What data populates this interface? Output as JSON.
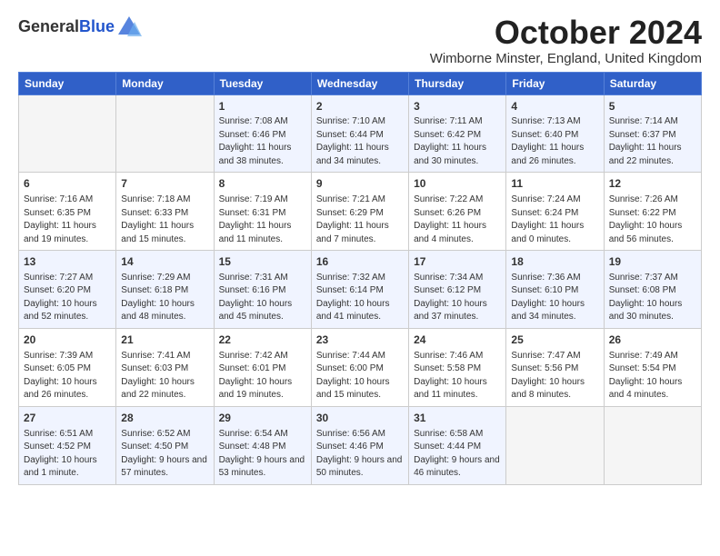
{
  "logo": {
    "general": "General",
    "blue": "Blue"
  },
  "title": "October 2024",
  "subtitle": "Wimborne Minster, England, United Kingdom",
  "days_of_week": [
    "Sunday",
    "Monday",
    "Tuesday",
    "Wednesday",
    "Thursday",
    "Friday",
    "Saturday"
  ],
  "weeks": [
    [
      {
        "day": "",
        "info": ""
      },
      {
        "day": "",
        "info": ""
      },
      {
        "day": "1",
        "info": "Sunrise: 7:08 AM\nSunset: 6:46 PM\nDaylight: 11 hours and 38 minutes."
      },
      {
        "day": "2",
        "info": "Sunrise: 7:10 AM\nSunset: 6:44 PM\nDaylight: 11 hours and 34 minutes."
      },
      {
        "day": "3",
        "info": "Sunrise: 7:11 AM\nSunset: 6:42 PM\nDaylight: 11 hours and 30 minutes."
      },
      {
        "day": "4",
        "info": "Sunrise: 7:13 AM\nSunset: 6:40 PM\nDaylight: 11 hours and 26 minutes."
      },
      {
        "day": "5",
        "info": "Sunrise: 7:14 AM\nSunset: 6:37 PM\nDaylight: 11 hours and 22 minutes."
      }
    ],
    [
      {
        "day": "6",
        "info": "Sunrise: 7:16 AM\nSunset: 6:35 PM\nDaylight: 11 hours and 19 minutes."
      },
      {
        "day": "7",
        "info": "Sunrise: 7:18 AM\nSunset: 6:33 PM\nDaylight: 11 hours and 15 minutes."
      },
      {
        "day": "8",
        "info": "Sunrise: 7:19 AM\nSunset: 6:31 PM\nDaylight: 11 hours and 11 minutes."
      },
      {
        "day": "9",
        "info": "Sunrise: 7:21 AM\nSunset: 6:29 PM\nDaylight: 11 hours and 7 minutes."
      },
      {
        "day": "10",
        "info": "Sunrise: 7:22 AM\nSunset: 6:26 PM\nDaylight: 11 hours and 4 minutes."
      },
      {
        "day": "11",
        "info": "Sunrise: 7:24 AM\nSunset: 6:24 PM\nDaylight: 11 hours and 0 minutes."
      },
      {
        "day": "12",
        "info": "Sunrise: 7:26 AM\nSunset: 6:22 PM\nDaylight: 10 hours and 56 minutes."
      }
    ],
    [
      {
        "day": "13",
        "info": "Sunrise: 7:27 AM\nSunset: 6:20 PM\nDaylight: 10 hours and 52 minutes."
      },
      {
        "day": "14",
        "info": "Sunrise: 7:29 AM\nSunset: 6:18 PM\nDaylight: 10 hours and 48 minutes."
      },
      {
        "day": "15",
        "info": "Sunrise: 7:31 AM\nSunset: 6:16 PM\nDaylight: 10 hours and 45 minutes."
      },
      {
        "day": "16",
        "info": "Sunrise: 7:32 AM\nSunset: 6:14 PM\nDaylight: 10 hours and 41 minutes."
      },
      {
        "day": "17",
        "info": "Sunrise: 7:34 AM\nSunset: 6:12 PM\nDaylight: 10 hours and 37 minutes."
      },
      {
        "day": "18",
        "info": "Sunrise: 7:36 AM\nSunset: 6:10 PM\nDaylight: 10 hours and 34 minutes."
      },
      {
        "day": "19",
        "info": "Sunrise: 7:37 AM\nSunset: 6:08 PM\nDaylight: 10 hours and 30 minutes."
      }
    ],
    [
      {
        "day": "20",
        "info": "Sunrise: 7:39 AM\nSunset: 6:05 PM\nDaylight: 10 hours and 26 minutes."
      },
      {
        "day": "21",
        "info": "Sunrise: 7:41 AM\nSunset: 6:03 PM\nDaylight: 10 hours and 22 minutes."
      },
      {
        "day": "22",
        "info": "Sunrise: 7:42 AM\nSunset: 6:01 PM\nDaylight: 10 hours and 19 minutes."
      },
      {
        "day": "23",
        "info": "Sunrise: 7:44 AM\nSunset: 6:00 PM\nDaylight: 10 hours and 15 minutes."
      },
      {
        "day": "24",
        "info": "Sunrise: 7:46 AM\nSunset: 5:58 PM\nDaylight: 10 hours and 11 minutes."
      },
      {
        "day": "25",
        "info": "Sunrise: 7:47 AM\nSunset: 5:56 PM\nDaylight: 10 hours and 8 minutes."
      },
      {
        "day": "26",
        "info": "Sunrise: 7:49 AM\nSunset: 5:54 PM\nDaylight: 10 hours and 4 minutes."
      }
    ],
    [
      {
        "day": "27",
        "info": "Sunrise: 6:51 AM\nSunset: 4:52 PM\nDaylight: 10 hours and 1 minute."
      },
      {
        "day": "28",
        "info": "Sunrise: 6:52 AM\nSunset: 4:50 PM\nDaylight: 9 hours and 57 minutes."
      },
      {
        "day": "29",
        "info": "Sunrise: 6:54 AM\nSunset: 4:48 PM\nDaylight: 9 hours and 53 minutes."
      },
      {
        "day": "30",
        "info": "Sunrise: 6:56 AM\nSunset: 4:46 PM\nDaylight: 9 hours and 50 minutes."
      },
      {
        "day": "31",
        "info": "Sunrise: 6:58 AM\nSunset: 4:44 PM\nDaylight: 9 hours and 46 minutes."
      },
      {
        "day": "",
        "info": ""
      },
      {
        "day": "",
        "info": ""
      }
    ]
  ]
}
